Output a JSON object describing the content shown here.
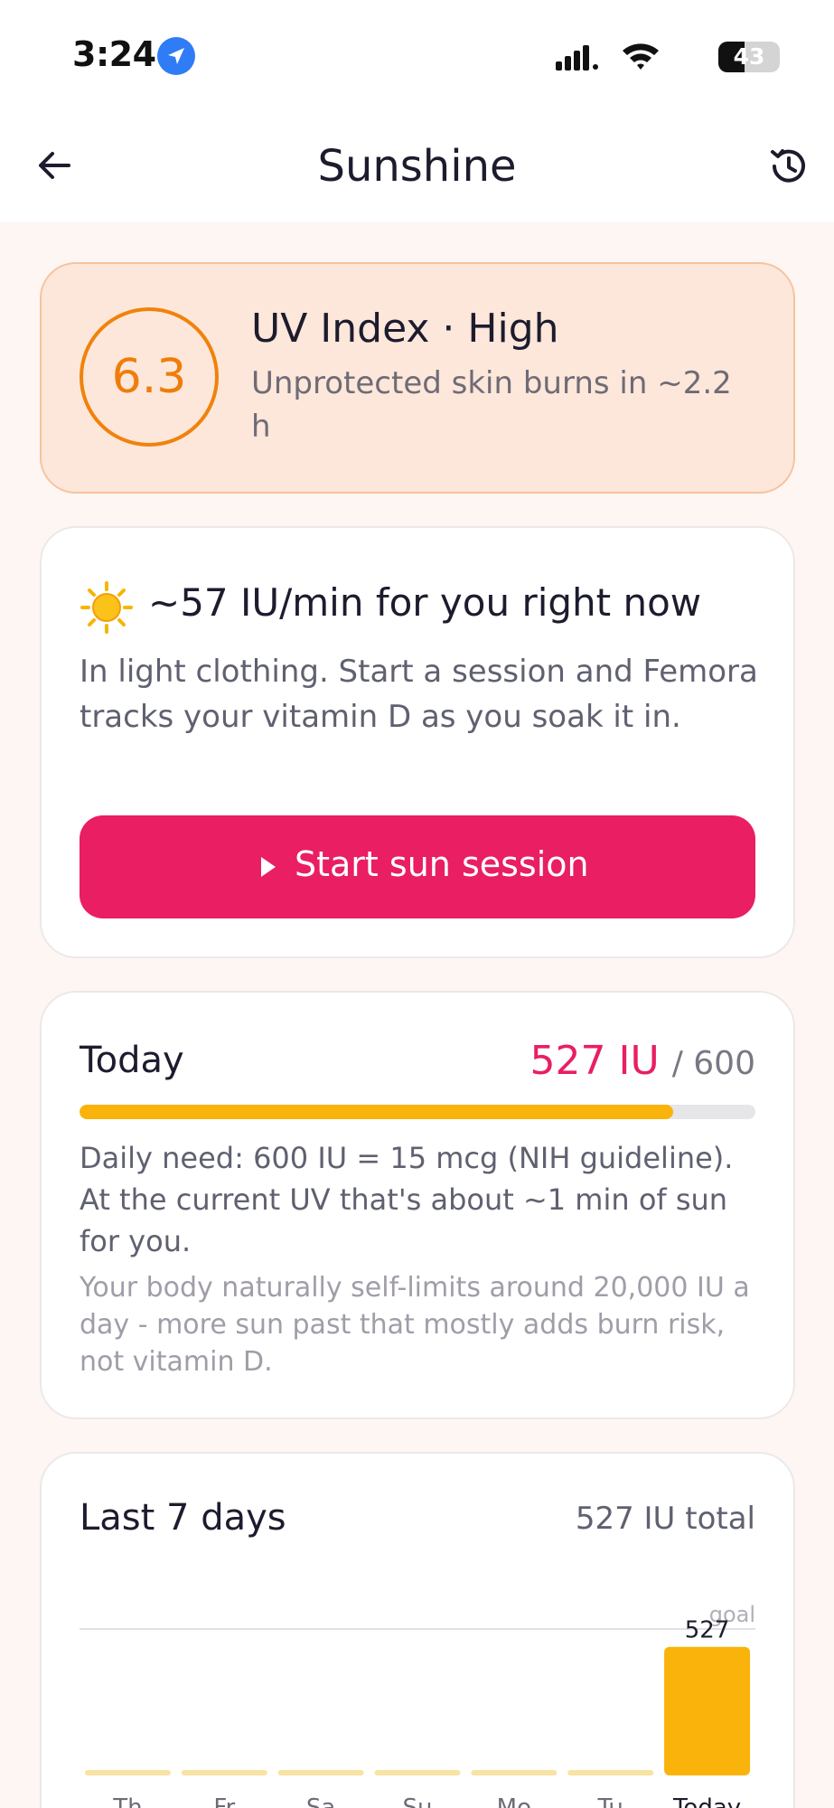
{
  "status_bar": {
    "time": "3:24",
    "battery_percent": "43",
    "battery_level": 0.43,
    "icons": [
      "location-arrow-icon",
      "cellular-signal-icon",
      "wifi-icon",
      "battery-icon"
    ]
  },
  "header": {
    "title": "Sunshine",
    "back_icon": "arrow-left-icon",
    "history_icon": "history-clock-icon"
  },
  "uv_card": {
    "uv_value": "6.3",
    "title": "UV Index · High",
    "subtitle": "Unprotected skin burns in ~2.2 h"
  },
  "rate_card": {
    "icon": "sun-icon",
    "title": "~57 IU/min for you right now",
    "description": "In light clothing. Start a session and Femora tracks your vitamin D as you soak it in.",
    "button_label": "Start sun session",
    "button_icon": "play-icon"
  },
  "today_card": {
    "label": "Today",
    "value": "527 IU",
    "goal": "/ 600",
    "progress": 0.878,
    "need_text": "Daily need: 600 IU = 15 mcg (NIH guideline). At the current UV that's about ~1 min of sun for you.",
    "limit_text": "Your body naturally self-limits around 20,000 IU a day - more sun past that mostly adds burn risk, not vitamin D."
  },
  "week_card": {
    "title": "Last 7 days",
    "total": "527 IU total"
  },
  "colors": {
    "accent": "#e91e63",
    "uv_orange": "#ef7d0b",
    "bar": "#f9b30a",
    "bar_empty": "#f8e3a3"
  },
  "chart_data": {
    "type": "bar",
    "categories": [
      "Th",
      "Fr",
      "Sa",
      "Su",
      "Mo",
      "Tu",
      "Today"
    ],
    "values": [
      0,
      0,
      0,
      0,
      0,
      0,
      527
    ],
    "data_labels": [
      "",
      "",
      "",
      "",
      "",
      "",
      "527"
    ],
    "goal": 600,
    "goal_label": "goal",
    "ylim": [
      0,
      600
    ]
  }
}
